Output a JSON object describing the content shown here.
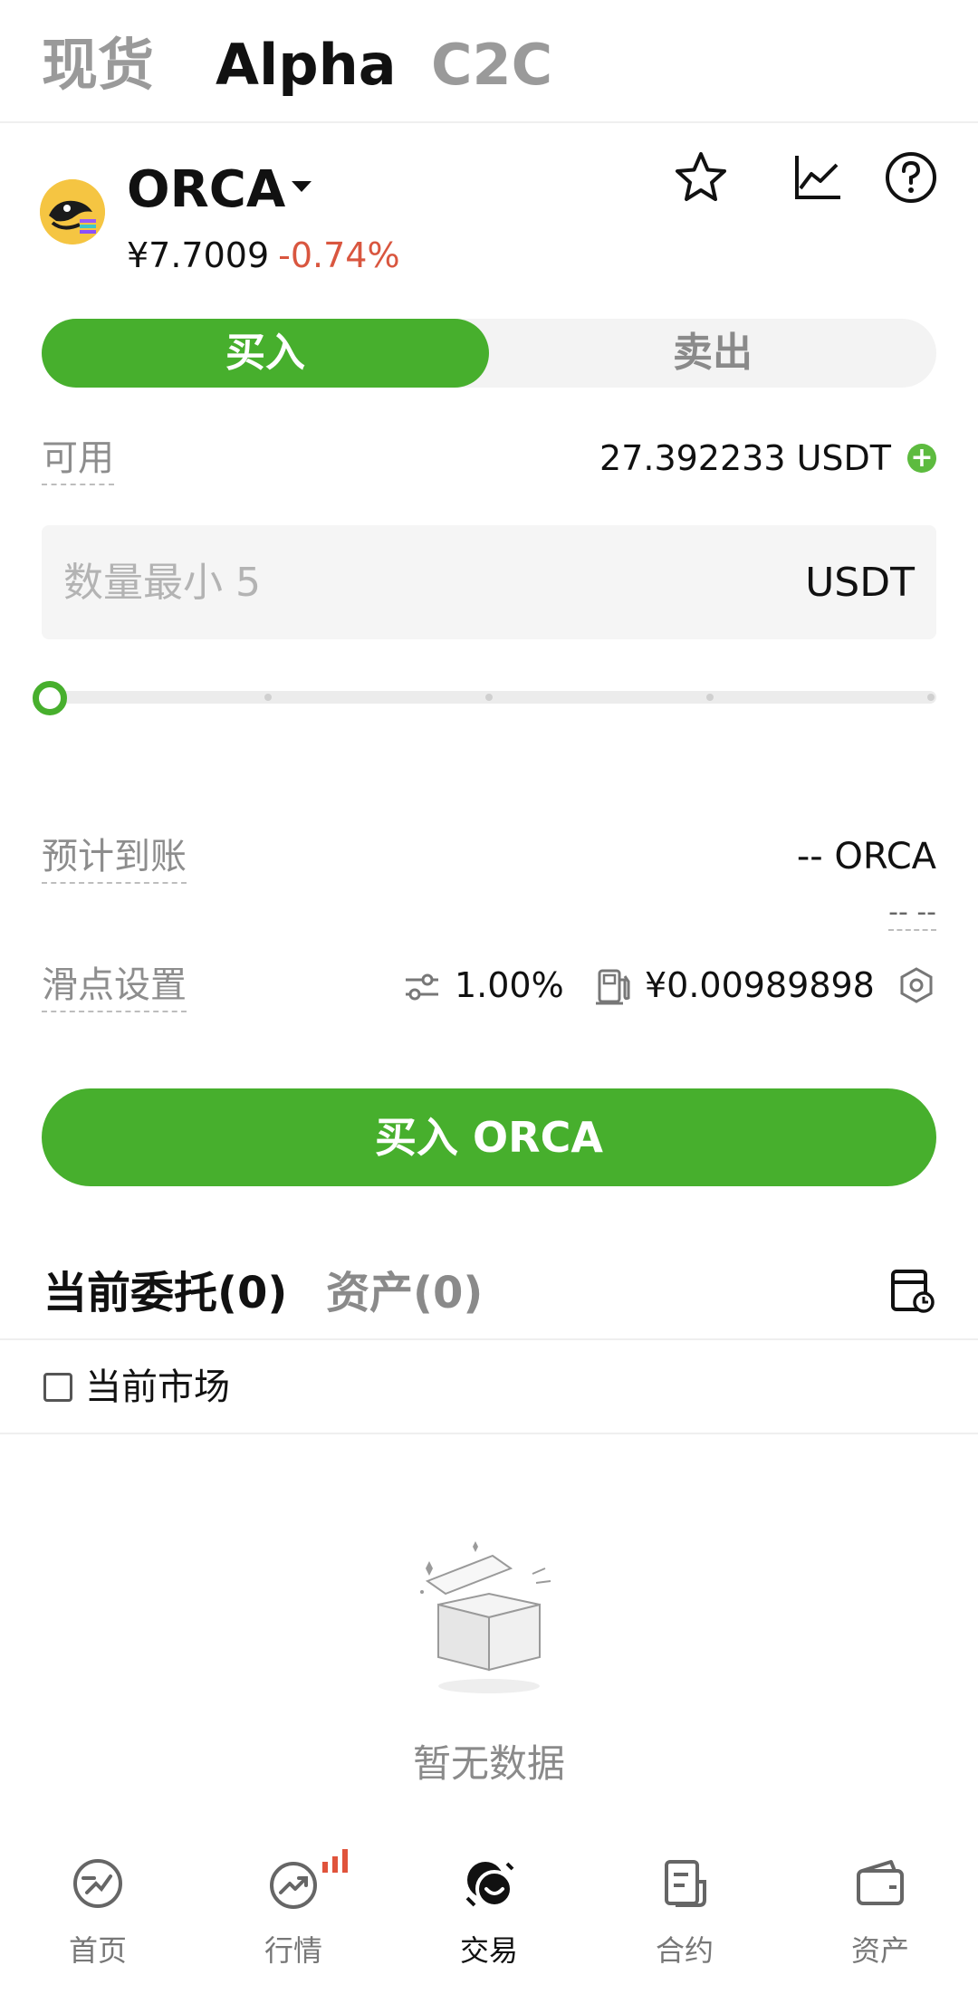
{
  "top_tabs": [
    {
      "label": "现货",
      "active": false
    },
    {
      "label": "Alpha",
      "active": true
    },
    {
      "label": "C2C",
      "active": false
    }
  ],
  "coin": {
    "name": "ORCA",
    "price": "¥7.7009",
    "change": "-0.74%",
    "change_color": "#d9563f",
    "logo_icon": "orca-logo"
  },
  "header_icons": [
    "star-icon",
    "chart-icon",
    "help-icon"
  ],
  "trade_toggle": {
    "buy": "买入",
    "sell": "卖出",
    "active": "buy"
  },
  "available": {
    "label": "可用",
    "value": "27.392233 USDT",
    "add_icon": "plus-icon"
  },
  "amount": {
    "placeholder": "数量最小 5",
    "value": "",
    "unit": "USDT"
  },
  "slider": {
    "value_percent": 0
  },
  "estimate": {
    "label": "预计到账",
    "value": "-- ORCA",
    "sub": "-- --"
  },
  "slippage": {
    "label": "滑点设置",
    "value": "1.00%",
    "gas": "¥0.00989898"
  },
  "buy_button": "买入 ORCA",
  "order_tabs": [
    {
      "label": "当前委托(0)",
      "active": true
    },
    {
      "label": "资产(0)",
      "active": false
    }
  ],
  "current_market": {
    "label": "当前市场",
    "checked": false
  },
  "empty_state": "暂无数据",
  "bottom_nav": [
    {
      "label": "首页",
      "icon": "home-icon",
      "active": false
    },
    {
      "label": "行情",
      "icon": "market-icon",
      "active": false
    },
    {
      "label": "交易",
      "icon": "trade-icon",
      "active": true
    },
    {
      "label": "合约",
      "icon": "futures-icon",
      "active": false
    },
    {
      "label": "资产",
      "icon": "wallet-icon",
      "active": false
    }
  ],
  "colors": {
    "accent": "#47af2d",
    "negative": "#d9563f"
  }
}
